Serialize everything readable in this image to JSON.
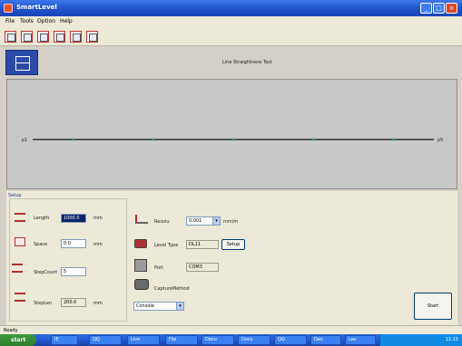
{
  "window": {
    "title": "SmartLevel"
  },
  "menu": [
    "File",
    "Tools",
    "Option",
    "Help"
  ],
  "toolbar": {
    "icons": [
      "line-straightness-icon",
      "flatness-icon",
      "tool-icon",
      "grid-icon",
      "save-icon",
      "print-icon"
    ]
  },
  "header": {
    "title": "Line Straightness Test"
  },
  "graph": {
    "start_label": "p1",
    "end_label": "p5",
    "point_count": 5
  },
  "setup": {
    "title": "Setup",
    "length": {
      "label": "Length",
      "value": "1000.0",
      "unit": "mm"
    },
    "space": {
      "label": "Space",
      "value": "0.0",
      "unit": "mm"
    },
    "step_count": {
      "label": "StepCount",
      "value": "5"
    },
    "step_len": {
      "label": "StepLen",
      "value": "200.0",
      "unit": "mm"
    }
  },
  "instrument": {
    "resolution": {
      "label": "Resolu",
      "value": "0.001",
      "unit": "mm/m"
    },
    "level_type": {
      "label": "Level Type",
      "value": "DL11",
      "setup_button": "Setup"
    },
    "port": {
      "label": "Port",
      "value": "COM3"
    },
    "capture": {
      "label": "CaptureMethod",
      "value": "Console"
    }
  },
  "actions": {
    "start": "Start"
  },
  "status": {
    "text": "Ready"
  },
  "taskbar": {
    "start": "start",
    "tasks": [
      "IE",
      "QQ",
      "Live",
      "File",
      "Docu",
      "Docs",
      "QQ",
      "Dev",
      "Lev"
    ],
    "clock": "11:15"
  },
  "colors": {
    "titlebar": "#245edb",
    "graph_bg": "#c8c8c8",
    "mode_box": "#2c4aa8"
  }
}
